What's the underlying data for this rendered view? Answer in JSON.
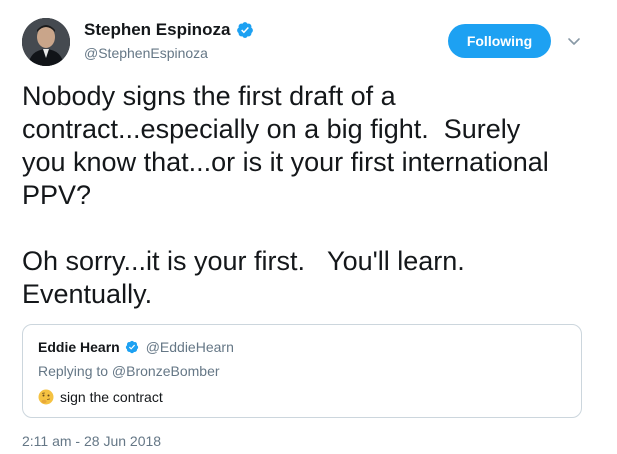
{
  "tweet": {
    "author_name": "Stephen Espinoza",
    "author_handle": "@StephenEspinoza",
    "follow_label": "Following",
    "text": "Nobody signs the first draft of a\ncontract...especially on a big fight.  Surely\nyou know that...or is it your first international\nPPV?\n\nOh sorry...it is your first.   You'll learn.\nEventually.",
    "timestamp": "2:11 am - 28 Jun 2018"
  },
  "quoted": {
    "author_name": "Eddie Hearn",
    "author_handle": "@EddieHearn",
    "reply_line": "Replying to @BronzeBomber",
    "emoji_icon": "thinking-face-emoji",
    "text": "sign the contract"
  },
  "colors": {
    "accent": "#1da1f2",
    "secondary_text": "#657786",
    "border": "#ccd6dd"
  }
}
